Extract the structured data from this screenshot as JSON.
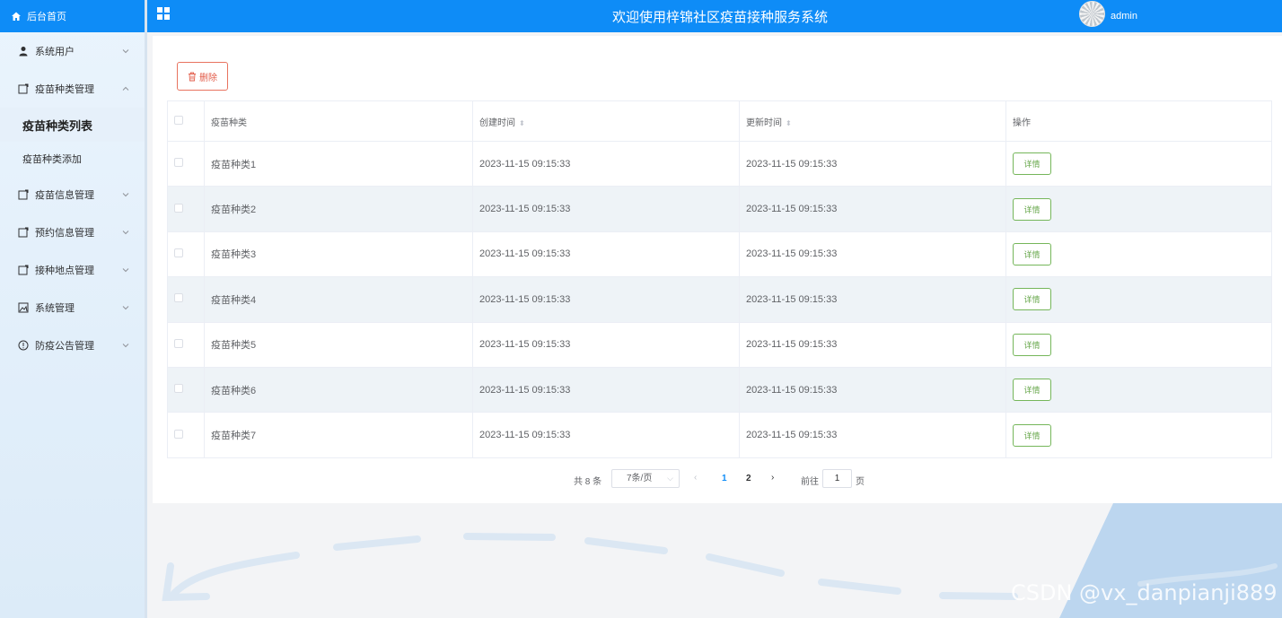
{
  "sidebar": {
    "home_label": "后台首页",
    "items": [
      {
        "label": "系统用户"
      },
      {
        "label": "疫苗种类管理"
      },
      {
        "label": "疫苗信息管理"
      },
      {
        "label": "预约信息管理"
      },
      {
        "label": "接种地点管理"
      },
      {
        "label": "系统管理"
      },
      {
        "label": "防疫公告管理"
      }
    ],
    "sub_items": [
      {
        "label": "疫苗种类列表"
      },
      {
        "label": "疫苗种类添加"
      }
    ]
  },
  "header": {
    "title": "欢迎使用梓锦社区疫苗接种服务系统",
    "username": "admin"
  },
  "toolbar": {
    "delete_label": "删除"
  },
  "table": {
    "columns": [
      "疫苗种类",
      "创建时间",
      "更新时间",
      "操作"
    ],
    "rows": [
      {
        "name": "疫苗种类1",
        "created": "2023-11-15 09:15:33",
        "updated": "2023-11-15 09:15:33"
      },
      {
        "name": "疫苗种类2",
        "created": "2023-11-15 09:15:33",
        "updated": "2023-11-15 09:15:33"
      },
      {
        "name": "疫苗种类3",
        "created": "2023-11-15 09:15:33",
        "updated": "2023-11-15 09:15:33"
      },
      {
        "name": "疫苗种类4",
        "created": "2023-11-15 09:15:33",
        "updated": "2023-11-15 09:15:33"
      },
      {
        "name": "疫苗种类5",
        "created": "2023-11-15 09:15:33",
        "updated": "2023-11-15 09:15:33"
      },
      {
        "name": "疫苗种类6",
        "created": "2023-11-15 09:15:33",
        "updated": "2023-11-15 09:15:33"
      },
      {
        "name": "疫苗种类7",
        "created": "2023-11-15 09:15:33",
        "updated": "2023-11-15 09:15:33"
      }
    ],
    "detail_label": "详情"
  },
  "pagination": {
    "total": "共 8 条",
    "page_size": "7条/页",
    "pages": [
      "1",
      "2"
    ],
    "goto_label": "前往",
    "goto_value": "1",
    "page_suffix": "页"
  },
  "watermark": "CSDN @vx_danpianji889",
  "colors": {
    "primary": "#0e8cf7",
    "danger": "#e25b48",
    "success": "#67a74b"
  }
}
